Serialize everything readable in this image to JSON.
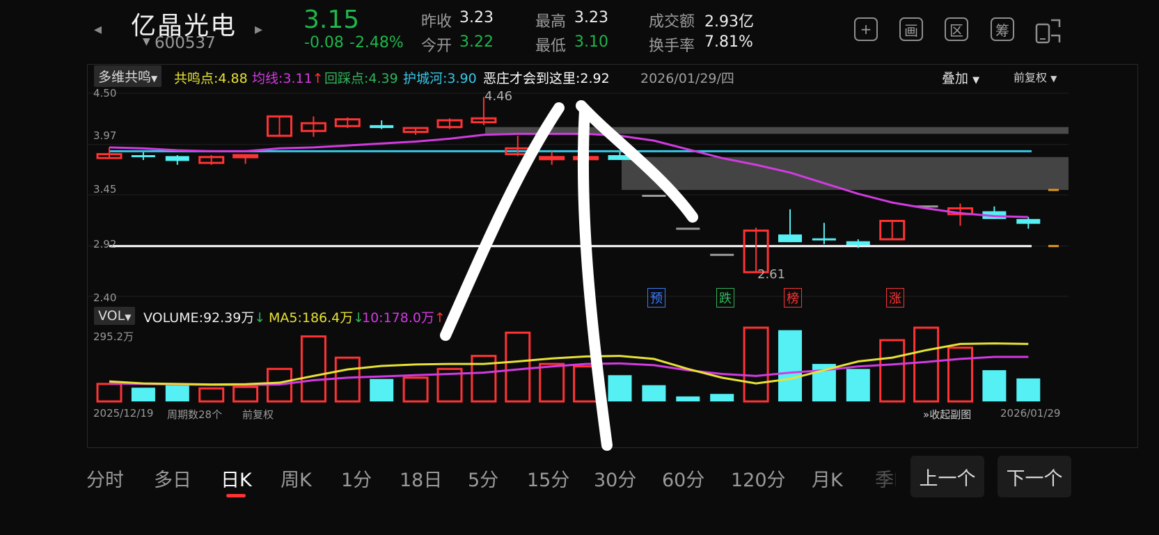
{
  "header": {
    "prev_icon": "chevron-left-icon",
    "next_icon": "chevron-right-icon",
    "name": "亿晶光电",
    "code": "600537",
    "price": "3.15",
    "change": "-0.08",
    "change_pct": "-2.48%",
    "stats": {
      "prev_close_label": "昨收",
      "prev_close": "3.23",
      "open_label": "今开",
      "open": "3.22",
      "high_label": "最高",
      "high": "3.23",
      "low_label": "最低",
      "low": "3.10",
      "amount_label": "成交额",
      "amount": "2.93亿",
      "turnover_label": "换手率",
      "turnover": "7.81%"
    },
    "tools": [
      {
        "glyph": "+",
        "icon": "plus-icon"
      },
      {
        "glyph": "画",
        "icon": "draw-icon"
      },
      {
        "glyph": "区",
        "icon": "range-icon"
      },
      {
        "glyph": "筹",
        "icon": "chips-icon"
      },
      {
        "glyph": "",
        "icon": "rotate-screen-icon"
      }
    ]
  },
  "chart": {
    "indicator_tag": "多维共鸣",
    "legend": [
      {
        "text": "共鸣点:4.88",
        "color": "#e6e235"
      },
      {
        "text": "均线:3.11",
        "color": "#d23be0",
        "arrow": "↑",
        "arrow_color": "#ff3333"
      },
      {
        "text": "回踩点:4.39",
        "color": "#2fb65a"
      },
      {
        "text": "护城河:3.90",
        "color": "#36c8e6"
      },
      {
        "text": "恶庄才会到这里:2.92",
        "color": "#ffffff"
      }
    ],
    "date_label": "2026/01/29/四",
    "overlay_label": "叠加",
    "adjust_label": "前复权",
    "y_ticks": [
      "4.50",
      "3.97",
      "3.45",
      "2.92",
      "2.40"
    ],
    "high_mark": "4.46",
    "low_mark": "2.61",
    "signals": [
      {
        "text": "预",
        "color": "#3b7bff"
      },
      {
        "text": "跌",
        "color": "#2fb65a"
      },
      {
        "text": "榜",
        "color": "#ff3333"
      },
      {
        "text": "涨",
        "color": "#ff3333"
      }
    ],
    "vol_tag": "VOL",
    "vol_legend": [
      {
        "text": "VOLUME:92.39万",
        "color": "#efefef",
        "arrow": "↓",
        "arrow_color": "#2fb65a"
      },
      {
        "text": "MA5:186.4万",
        "color": "#e6e235",
        "arrow": "↓",
        "arrow_color": "#2fb65a"
      },
      {
        "text": "10:178.0万",
        "color": "#d23be0",
        "arrow": "↑",
        "arrow_color": "#ff3333"
      }
    ],
    "vol_max": "295.2万",
    "start_date": "2025/12/19",
    "period_count": "周期数28个",
    "adjust_footer": "前复权",
    "collapse_label": "收起副图",
    "end_date": "2026/01/29"
  },
  "chart_data": {
    "type": "candlestick",
    "ylim": [
      2.4,
      4.5
    ],
    "horizontal_lines": [
      {
        "value": 3.9,
        "color": "#36c8e6"
      },
      {
        "value": 2.92,
        "color": "#ffffff"
      }
    ],
    "candles": [
      {
        "o": 3.87,
        "h": 3.94,
        "l": 3.83,
        "c": 3.83,
        "up": true
      },
      {
        "o": 3.86,
        "h": 3.89,
        "l": 3.81,
        "c": 3.84,
        "up": false
      },
      {
        "o": 3.85,
        "h": 3.86,
        "l": 3.76,
        "c": 3.8,
        "up": false
      },
      {
        "o": 3.78,
        "h": 3.86,
        "l": 3.76,
        "c": 3.84,
        "up": true
      },
      {
        "o": 3.84,
        "h": 3.87,
        "l": 3.77,
        "c": 3.86,
        "up": true
      },
      {
        "o": 4.06,
        "h": 4.27,
        "l": 4.06,
        "c": 4.26,
        "up": true
      },
      {
        "o": 4.11,
        "h": 4.26,
        "l": 4.05,
        "c": 4.19,
        "up": true
      },
      {
        "o": 4.16,
        "h": 4.25,
        "l": 4.14,
        "c": 4.23,
        "up": true
      },
      {
        "o": 4.17,
        "h": 4.22,
        "l": 4.13,
        "c": 4.14,
        "up": false
      },
      {
        "o": 4.1,
        "h": 4.14,
        "l": 4.07,
        "c": 4.14,
        "up": true
      },
      {
        "o": 4.15,
        "h": 4.24,
        "l": 4.13,
        "c": 4.22,
        "up": true
      },
      {
        "o": 4.2,
        "h": 4.46,
        "l": 4.17,
        "c": 4.24,
        "up": true
      },
      {
        "o": 3.93,
        "h": 4.06,
        "l": 3.85,
        "c": 3.87,
        "up": true
      },
      {
        "o": 3.84,
        "h": 3.9,
        "l": 3.76,
        "c": 3.84,
        "up": true
      },
      {
        "o": 3.84,
        "h": 3.9,
        "l": 3.79,
        "c": 3.82,
        "up": true
      },
      {
        "o": 3.86,
        "h": 3.89,
        "l": 3.81,
        "c": 3.81,
        "up": false
      },
      {
        "o": 3.45,
        "h": 3.45,
        "l": 3.45,
        "c": 3.45,
        "up": null
      },
      {
        "o": 3.11,
        "h": 3.11,
        "l": 3.11,
        "c": 3.11,
        "up": null
      },
      {
        "o": 2.84,
        "h": 2.84,
        "l": 2.84,
        "c": 2.84,
        "up": null
      },
      {
        "o": 2.65,
        "h": 3.11,
        "l": 2.65,
        "c": 3.08,
        "up": true
      },
      {
        "o": 3.04,
        "h": 3.3,
        "l": 2.96,
        "c": 2.96,
        "up": false
      },
      {
        "o": 3.0,
        "h": 3.16,
        "l": 2.94,
        "c": 2.98,
        "up": false
      },
      {
        "o": 2.97,
        "h": 2.99,
        "l": 2.9,
        "c": 2.93,
        "up": false
      },
      {
        "o": 2.99,
        "h": 3.19,
        "l": 2.99,
        "c": 3.18,
        "up": true
      },
      {
        "o": 3.34,
        "h": 3.34,
        "l": 3.34,
        "c": 3.34,
        "up": null
      },
      {
        "o": 3.25,
        "h": 3.36,
        "l": 3.13,
        "c": 3.31,
        "up": true
      },
      {
        "o": 3.28,
        "h": 3.33,
        "l": 3.2,
        "c": 3.2,
        "up": false
      },
      {
        "o": 3.2,
        "h": 3.22,
        "l": 3.1,
        "c": 3.15,
        "up": false
      }
    ],
    "ma_line": [
      3.94,
      3.93,
      3.91,
      3.9,
      3.9,
      3.93,
      3.94,
      3.96,
      3.98,
      4.0,
      4.03,
      4.07,
      4.08,
      4.08,
      4.08,
      4.06,
      4.01,
      3.92,
      3.83,
      3.76,
      3.68,
      3.57,
      3.46,
      3.37,
      3.31,
      3.26,
      3.23,
      3.22
    ],
    "volume_series": [
      {
        "v": 70,
        "up": true
      },
      {
        "v": 55,
        "up": false
      },
      {
        "v": 65,
        "up": false
      },
      {
        "v": 52,
        "up": true
      },
      {
        "v": 58,
        "up": true
      },
      {
        "v": 130,
        "up": true
      },
      {
        "v": 260,
        "up": true
      },
      {
        "v": 175,
        "up": true
      },
      {
        "v": 90,
        "up": false
      },
      {
        "v": 95,
        "up": true
      },
      {
        "v": 130,
        "up": true
      },
      {
        "v": 182,
        "up": true
      },
      {
        "v": 275,
        "up": true
      },
      {
        "v": 150,
        "up": true
      },
      {
        "v": 140,
        "up": true
      },
      {
        "v": 105,
        "up": false
      },
      {
        "v": 65,
        "up": false
      },
      {
        "v": 20,
        "up": false
      },
      {
        "v": 30,
        "up": false
      },
      {
        "v": 295,
        "up": true
      },
      {
        "v": 285,
        "up": false
      },
      {
        "v": 150,
        "up": false
      },
      {
        "v": 130,
        "up": false
      },
      {
        "v": 245,
        "up": true
      },
      {
        "v": 295,
        "up": true
      },
      {
        "v": 215,
        "up": true
      },
      {
        "v": 125,
        "up": false
      },
      {
        "v": 92,
        "up": false
      }
    ],
    "ma5_volume": [
      80,
      72,
      70,
      68,
      69,
      75,
      102,
      128,
      142,
      148,
      150,
      150,
      160,
      172,
      180,
      182,
      170,
      130,
      95,
      72,
      90,
      125,
      160,
      175,
      205,
      230,
      232,
      230
    ],
    "ma10_volume": [
      72,
      70,
      68,
      66,
      66,
      68,
      85,
      95,
      100,
      105,
      110,
      115,
      128,
      140,
      150,
      152,
      145,
      125,
      110,
      102,
      115,
      125,
      140,
      148,
      158,
      170,
      178,
      178
    ]
  },
  "tabs": [
    "分时",
    "多日",
    "日K",
    "周K",
    "1分",
    "18日",
    "5分",
    "15分",
    "30分",
    "60分",
    "120分",
    "月K",
    "季K"
  ],
  "active_tab": "日K",
  "prev_label": "上一个",
  "next_label": "下一个"
}
